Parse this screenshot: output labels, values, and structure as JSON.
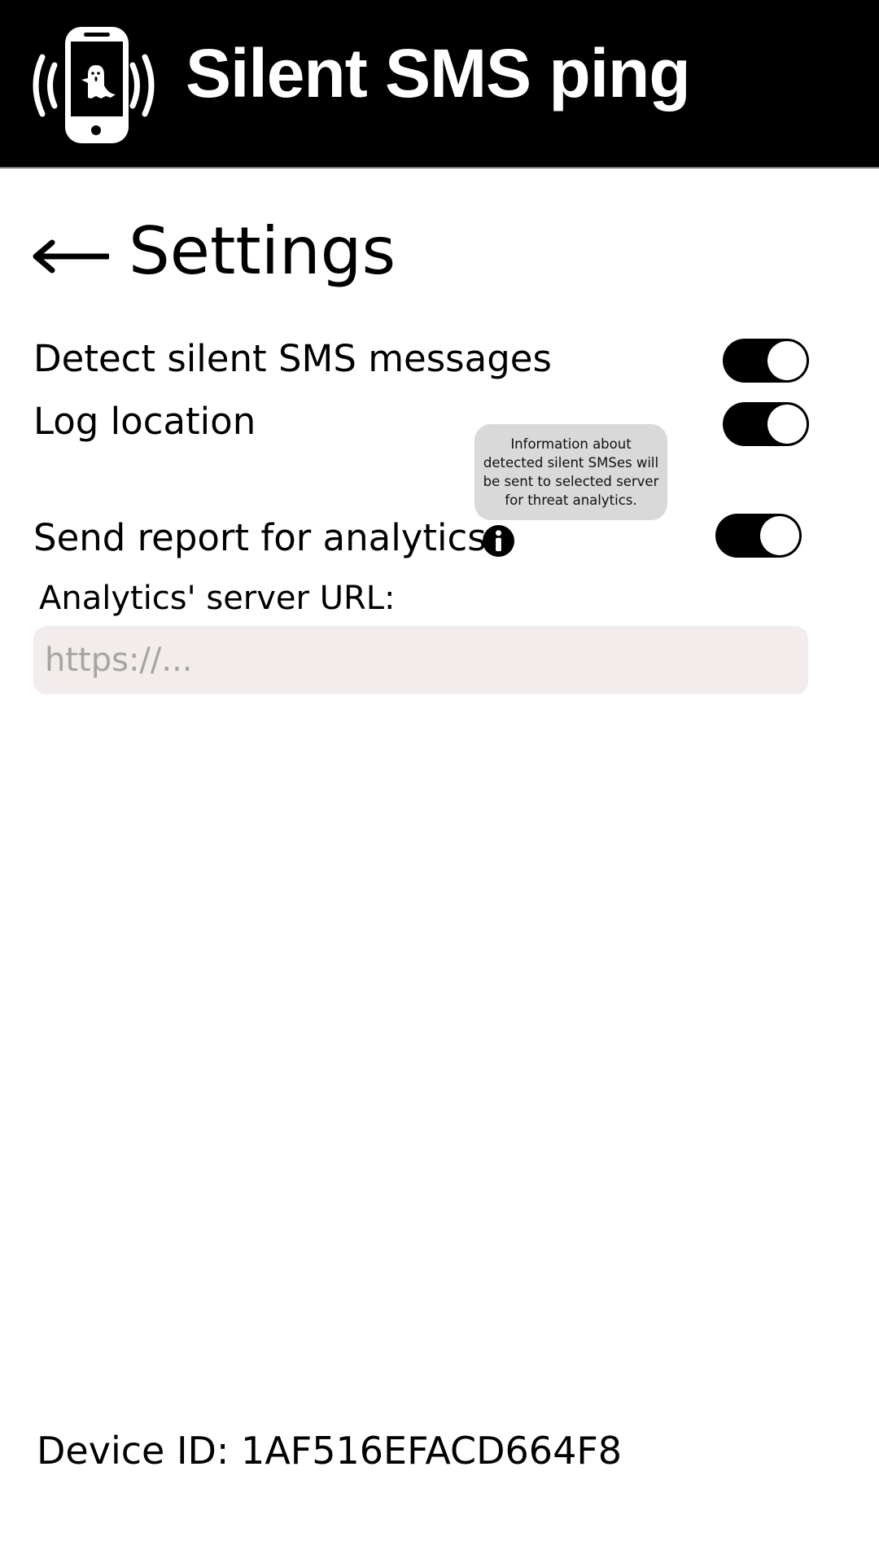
{
  "header": {
    "title": "Silent SMS ping",
    "logo_icon": "phone-ghost-vibrate-icon"
  },
  "page": {
    "title": "Settings",
    "back_icon": "arrow-left-icon"
  },
  "settings": [
    {
      "label": "Detect silent SMS messages",
      "enabled": true
    },
    {
      "label": "Log location",
      "enabled": true
    },
    {
      "label": "Send report for analytics",
      "enabled": true
    }
  ],
  "tooltip": {
    "text": "Information about detected silent SMSes will be sent to selected server for threat analytics."
  },
  "analytics": {
    "label": "Analytics' server URL:",
    "placeholder": "https://...",
    "value": ""
  },
  "device": {
    "label": "Device ID: 1AF516EFACD664F8"
  },
  "colors": {
    "header_bg": "#000000",
    "input_bg": "#f2ecec",
    "tooltip_bg": "#d9d9d9",
    "toggle_on": "#000000"
  }
}
